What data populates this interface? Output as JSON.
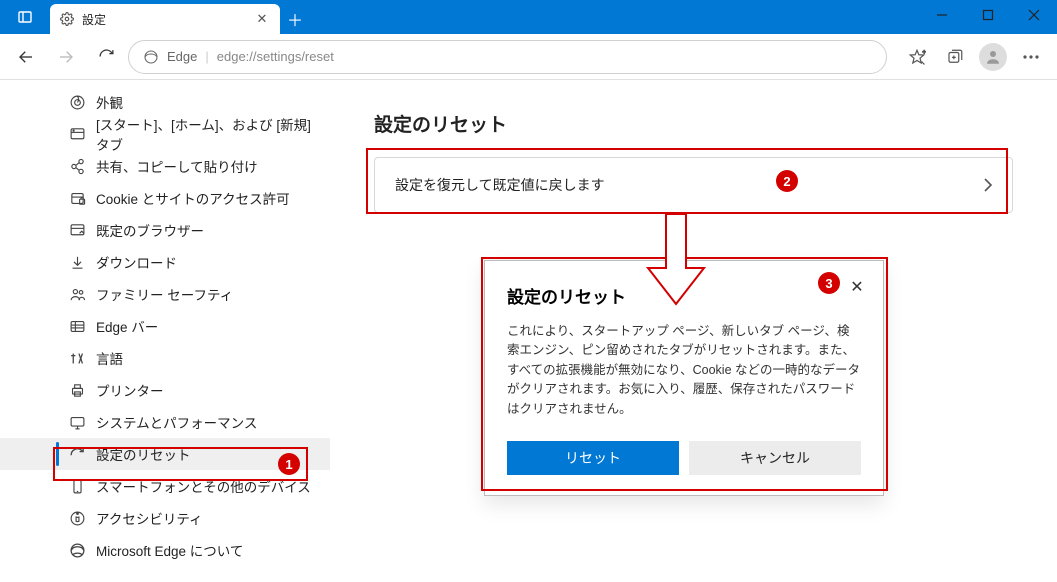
{
  "window": {
    "tab_title": "設定"
  },
  "addressbar": {
    "brand": "Edge",
    "path": "edge://settings/reset"
  },
  "sidebar": {
    "items": [
      {
        "label": "外観"
      },
      {
        "label": "[スタート]、[ホーム]、および [新規] タブ"
      },
      {
        "label": "共有、コピーして貼り付け"
      },
      {
        "label": "Cookie とサイトのアクセス許可"
      },
      {
        "label": "既定のブラウザー"
      },
      {
        "label": "ダウンロード"
      },
      {
        "label": "ファミリー セーフティ"
      },
      {
        "label": "Edge バー"
      },
      {
        "label": "言語"
      },
      {
        "label": "プリンター"
      },
      {
        "label": "システムとパフォーマンス"
      },
      {
        "label": "設定のリセット",
        "selected": true
      },
      {
        "label": "スマートフォンとその他のデバイス"
      },
      {
        "label": "アクセシビリティ"
      },
      {
        "label": "Microsoft Edge について"
      }
    ]
  },
  "main": {
    "heading": "設定のリセット",
    "restore_label": "設定を復元して既定値に戻します"
  },
  "dialog": {
    "title": "設定のリセット",
    "body": "これにより、スタートアップ ページ、新しいタブ ページ、検索エンジン、ピン留めされたタブがリセットされます。また、すべての拡張機能が無効になり、Cookie などの一時的なデータがクリアされます。お気に入り、履歴、保存されたパスワードはクリアされません。",
    "reset": "リセット",
    "cancel": "キャンセル"
  },
  "badges": {
    "b1": "1",
    "b2": "2",
    "b3": "3"
  }
}
